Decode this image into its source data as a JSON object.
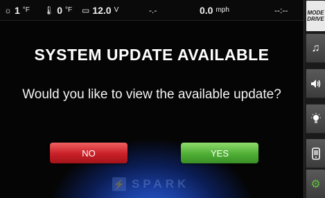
{
  "status": {
    "weather_icon": "weather-icon",
    "outside_temp_value": "1",
    "outside_temp_unit": "°F",
    "temp_icon": "thermometer-icon",
    "inside_temp_value": "0",
    "inside_temp_unit": "°F",
    "battery_icon": "battery-icon",
    "battery_value": "12.0",
    "battery_unit": "V",
    "placeholder_value": "-.-",
    "speed_value": "0.0",
    "speed_unit": "mph",
    "time_value": "--:--"
  },
  "dialog": {
    "title": "SYSTEM UPDATE AVAILABLE",
    "question": "Would you like to view the available update?",
    "no_label": "NO",
    "yes_label": "YES"
  },
  "logo": {
    "mark": "⚡",
    "text": "SPARK"
  },
  "side_panel": {
    "mode_line1": "MODE",
    "mode_line2": "DRIVE",
    "buttons": [
      "music-note-icon",
      "volume-icon",
      "light-bulb-icon",
      "phone-icon",
      "gear-icon"
    ]
  },
  "colors": {
    "no_button": "#c81f27",
    "yes_button": "#4fae35",
    "settings_icon": "#5fc23d",
    "background_glow": "#2b5fd4"
  }
}
